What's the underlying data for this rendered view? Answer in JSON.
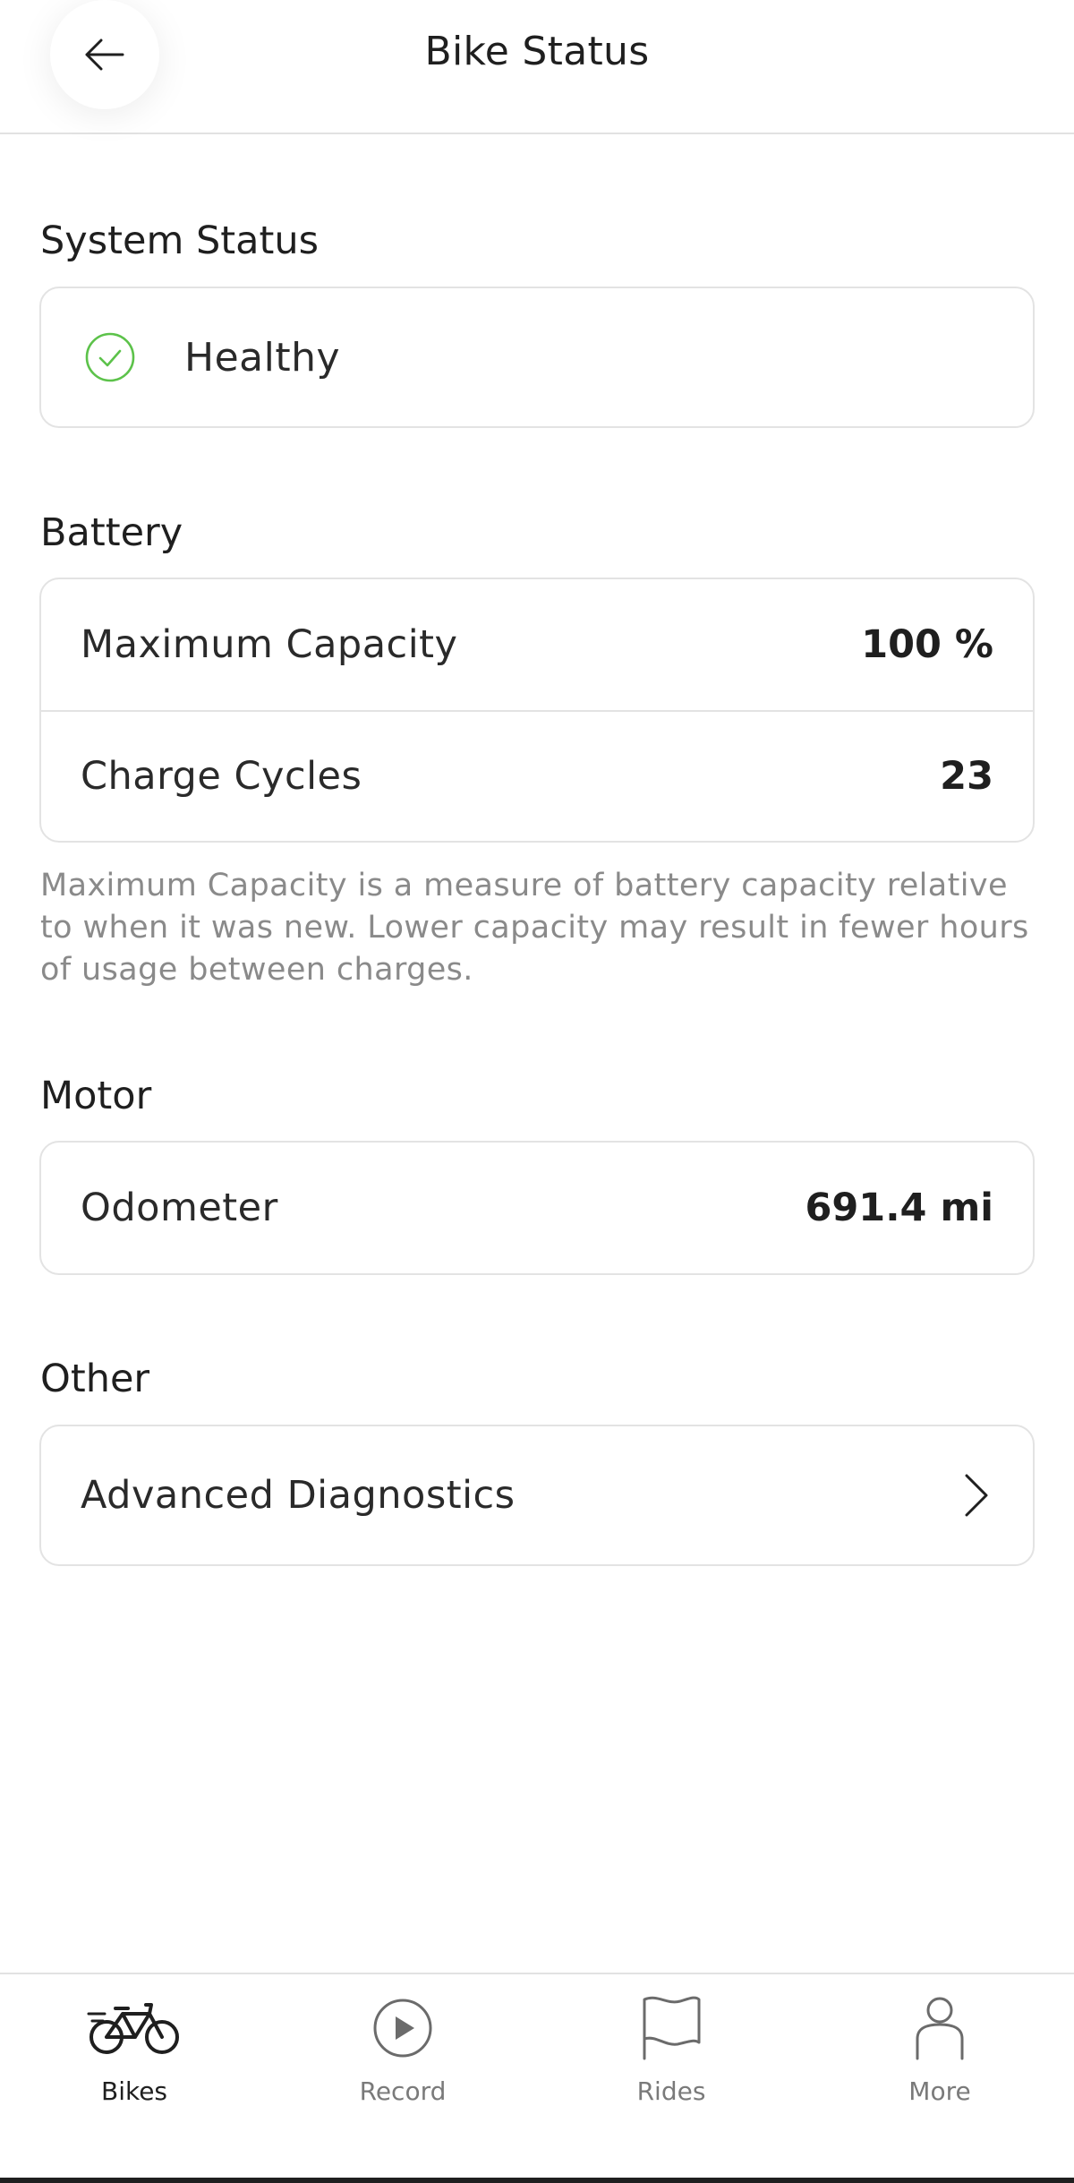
{
  "header": {
    "title": "Bike Status",
    "back_icon": "back-arrow-icon"
  },
  "system_status": {
    "title": "System Status",
    "status_label": "Healthy",
    "status_icon": "check-circle-icon",
    "status_color": "#5cc24a"
  },
  "battery": {
    "title": "Battery",
    "rows": [
      {
        "label": "Maximum Capacity",
        "value": "100 %"
      },
      {
        "label": "Charge Cycles",
        "value": "23"
      }
    ],
    "note": "Maximum Capacity is a measure of battery capacity relative to when it was new. Lower capacity may result in fewer hours of usage between charges."
  },
  "motor": {
    "title": "Motor",
    "rows": [
      {
        "label": "Odometer",
        "value": "691.4 mi"
      }
    ]
  },
  "other": {
    "title": "Other",
    "rows": [
      {
        "label": "Advanced Diagnostics",
        "icon": "chevron-right-icon"
      }
    ]
  },
  "bottom_nav": {
    "items": [
      {
        "label": "Bikes",
        "icon": "bike-icon",
        "active": true
      },
      {
        "label": "Record",
        "icon": "play-circle-icon",
        "active": false
      },
      {
        "label": "Rides",
        "icon": "flag-icon",
        "active": false
      },
      {
        "label": "More",
        "icon": "person-icon",
        "active": false
      }
    ]
  }
}
